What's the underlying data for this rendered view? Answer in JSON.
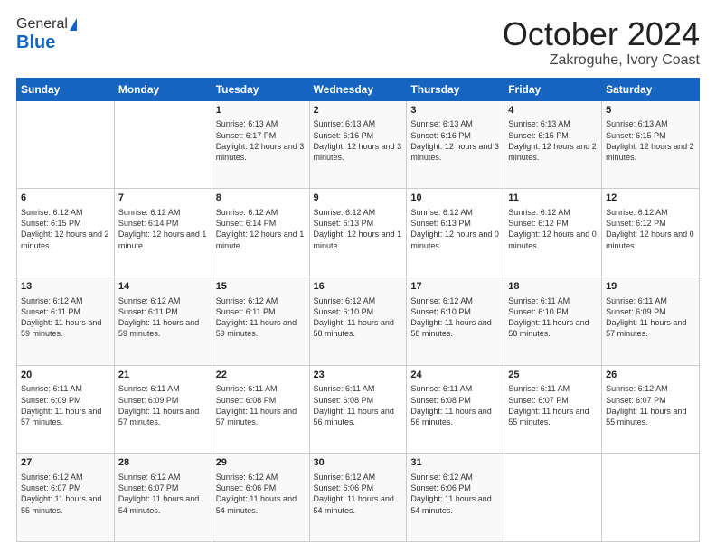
{
  "logo": {
    "general": "General",
    "blue": "Blue"
  },
  "title": "October 2024",
  "location": "Zakroguhe, Ivory Coast",
  "days_header": [
    "Sunday",
    "Monday",
    "Tuesday",
    "Wednesday",
    "Thursday",
    "Friday",
    "Saturday"
  ],
  "weeks": [
    [
      {
        "day": "",
        "content": ""
      },
      {
        "day": "",
        "content": ""
      },
      {
        "day": "1",
        "content": "Sunrise: 6:13 AM\nSunset: 6:17 PM\nDaylight: 12 hours and 3 minutes."
      },
      {
        "day": "2",
        "content": "Sunrise: 6:13 AM\nSunset: 6:16 PM\nDaylight: 12 hours and 3 minutes."
      },
      {
        "day": "3",
        "content": "Sunrise: 6:13 AM\nSunset: 6:16 PM\nDaylight: 12 hours and 3 minutes."
      },
      {
        "day": "4",
        "content": "Sunrise: 6:13 AM\nSunset: 6:15 PM\nDaylight: 12 hours and 2 minutes."
      },
      {
        "day": "5",
        "content": "Sunrise: 6:13 AM\nSunset: 6:15 PM\nDaylight: 12 hours and 2 minutes."
      }
    ],
    [
      {
        "day": "6",
        "content": "Sunrise: 6:12 AM\nSunset: 6:15 PM\nDaylight: 12 hours and 2 minutes."
      },
      {
        "day": "7",
        "content": "Sunrise: 6:12 AM\nSunset: 6:14 PM\nDaylight: 12 hours and 1 minute."
      },
      {
        "day": "8",
        "content": "Sunrise: 6:12 AM\nSunset: 6:14 PM\nDaylight: 12 hours and 1 minute."
      },
      {
        "day": "9",
        "content": "Sunrise: 6:12 AM\nSunset: 6:13 PM\nDaylight: 12 hours and 1 minute."
      },
      {
        "day": "10",
        "content": "Sunrise: 6:12 AM\nSunset: 6:13 PM\nDaylight: 12 hours and 0 minutes."
      },
      {
        "day": "11",
        "content": "Sunrise: 6:12 AM\nSunset: 6:12 PM\nDaylight: 12 hours and 0 minutes."
      },
      {
        "day": "12",
        "content": "Sunrise: 6:12 AM\nSunset: 6:12 PM\nDaylight: 12 hours and 0 minutes."
      }
    ],
    [
      {
        "day": "13",
        "content": "Sunrise: 6:12 AM\nSunset: 6:11 PM\nDaylight: 11 hours and 59 minutes."
      },
      {
        "day": "14",
        "content": "Sunrise: 6:12 AM\nSunset: 6:11 PM\nDaylight: 11 hours and 59 minutes."
      },
      {
        "day": "15",
        "content": "Sunrise: 6:12 AM\nSunset: 6:11 PM\nDaylight: 11 hours and 59 minutes."
      },
      {
        "day": "16",
        "content": "Sunrise: 6:12 AM\nSunset: 6:10 PM\nDaylight: 11 hours and 58 minutes."
      },
      {
        "day": "17",
        "content": "Sunrise: 6:12 AM\nSunset: 6:10 PM\nDaylight: 11 hours and 58 minutes."
      },
      {
        "day": "18",
        "content": "Sunrise: 6:11 AM\nSunset: 6:10 PM\nDaylight: 11 hours and 58 minutes."
      },
      {
        "day": "19",
        "content": "Sunrise: 6:11 AM\nSunset: 6:09 PM\nDaylight: 11 hours and 57 minutes."
      }
    ],
    [
      {
        "day": "20",
        "content": "Sunrise: 6:11 AM\nSunset: 6:09 PM\nDaylight: 11 hours and 57 minutes."
      },
      {
        "day": "21",
        "content": "Sunrise: 6:11 AM\nSunset: 6:09 PM\nDaylight: 11 hours and 57 minutes."
      },
      {
        "day": "22",
        "content": "Sunrise: 6:11 AM\nSunset: 6:08 PM\nDaylight: 11 hours and 57 minutes."
      },
      {
        "day": "23",
        "content": "Sunrise: 6:11 AM\nSunset: 6:08 PM\nDaylight: 11 hours and 56 minutes."
      },
      {
        "day": "24",
        "content": "Sunrise: 6:11 AM\nSunset: 6:08 PM\nDaylight: 11 hours and 56 minutes."
      },
      {
        "day": "25",
        "content": "Sunrise: 6:11 AM\nSunset: 6:07 PM\nDaylight: 11 hours and 55 minutes."
      },
      {
        "day": "26",
        "content": "Sunrise: 6:12 AM\nSunset: 6:07 PM\nDaylight: 11 hours and 55 minutes."
      }
    ],
    [
      {
        "day": "27",
        "content": "Sunrise: 6:12 AM\nSunset: 6:07 PM\nDaylight: 11 hours and 55 minutes."
      },
      {
        "day": "28",
        "content": "Sunrise: 6:12 AM\nSunset: 6:07 PM\nDaylight: 11 hours and 54 minutes."
      },
      {
        "day": "29",
        "content": "Sunrise: 6:12 AM\nSunset: 6:06 PM\nDaylight: 11 hours and 54 minutes."
      },
      {
        "day": "30",
        "content": "Sunrise: 6:12 AM\nSunset: 6:06 PM\nDaylight: 11 hours and 54 minutes."
      },
      {
        "day": "31",
        "content": "Sunrise: 6:12 AM\nSunset: 6:06 PM\nDaylight: 11 hours and 54 minutes."
      },
      {
        "day": "",
        "content": ""
      },
      {
        "day": "",
        "content": ""
      }
    ]
  ]
}
